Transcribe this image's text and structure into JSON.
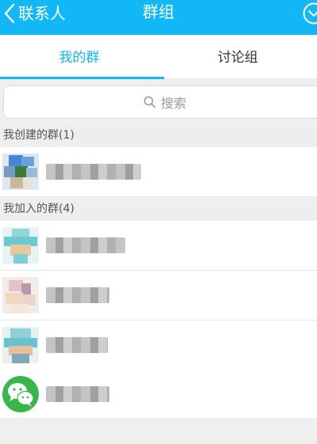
{
  "header": {
    "back_label": "联系人",
    "title": "群组"
  },
  "tabs": [
    {
      "label": "我的群",
      "active": true
    },
    {
      "label": "讨论组",
      "active": false
    }
  ],
  "search": {
    "placeholder": "搜索"
  },
  "sections": [
    {
      "title": "我创建的群(1)"
    },
    {
      "title": "我加入的群(4)"
    }
  ],
  "colors": {
    "accent": "#12b7f5",
    "wechat_green": "#39b54a"
  },
  "icons": {
    "back": "chevron-left-icon",
    "menu": "chevron-down-circle-icon",
    "search": "search-icon",
    "wechat": "wechat-icon"
  }
}
